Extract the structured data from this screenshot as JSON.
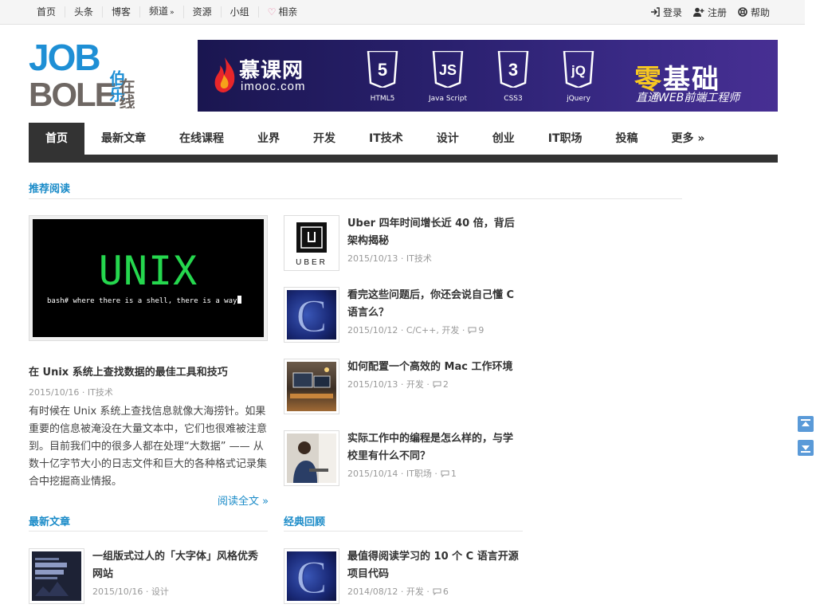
{
  "topbar": {
    "links": [
      "首页",
      "头条",
      "博客",
      "频道",
      "资源",
      "小组",
      "相亲"
    ],
    "login": "登录",
    "register": "注册",
    "help": "帮助"
  },
  "logo": {
    "text_en_1": "JOB",
    "text_en_2": "BOLE",
    "text_cn_1": "伯乐",
    "text_cn_2": "在线"
  },
  "banner": {
    "brand_cn": "慕课网",
    "brand_en": "imooc.com",
    "techs": [
      "HTML5",
      "Java Script",
      "CSS3",
      "jQuery"
    ],
    "headline": "零基础",
    "headline_accent": "零",
    "headline_rest": "基础",
    "subline": "直通WEB前端工程师"
  },
  "mainnav": [
    "首页",
    "最新文章",
    "在线课程",
    "业界",
    "开发",
    "IT技术",
    "设计",
    "创业",
    "IT职场",
    "投稿",
    "更多 »"
  ],
  "sections": {
    "recommend": "推荐阅读",
    "latest": "最新文章",
    "classic": "经典回顾"
  },
  "featured": {
    "image_title": "UNIX",
    "image_prompt": "bash# where there is a shell, there is a way",
    "title": "在 Unix 系统上查找数据的最佳工具和技巧",
    "meta": "2015/10/16 · IT技术",
    "desc": "有时候在 Unix 系统上查找信息就像大海捞针。如果重要的信息被淹没在大量文本中，它们也很难被注意到。目前我们中的很多人都在处理“大数据” —— 从数十亿字节大小的日志文件和巨大的各种格式记录集合中挖掘商业情报。",
    "more": "阅读全文 »"
  },
  "side_items": [
    {
      "title": "Uber 四年时间增长近 40 倍，背后架构揭秘",
      "meta": "2015/10/13 · IT技术",
      "comments": "",
      "thumb": "uber",
      "thumb_text": "UBER"
    },
    {
      "title": "看完这些问题后，你还会说自己懂 C 语言么？",
      "meta": "2015/10/12 · C/C++, 开发 ·",
      "comments": "9",
      "thumb": "c"
    },
    {
      "title": "如何配置一个高效的 Mac 工作环境",
      "meta": "2015/10/13 · 开发 ·",
      "comments": "2",
      "thumb": "mac"
    },
    {
      "title": "实际工作中的编程是怎么样的，与学校里有什么不同？",
      "meta": "2015/10/14 · IT职场 ·",
      "comments": "1",
      "thumb": "work"
    }
  ],
  "latest_items": [
    {
      "title": "一组版式过人的「大字体」风格优秀网站",
      "meta": "2015/10/16 · 设计",
      "thumb": "font"
    }
  ],
  "classic_items": [
    {
      "title": "最值得阅读学习的 10 个 C 语言开源项目代码",
      "meta": "2014/08/12 · 开发 ·",
      "comments": "6",
      "thumb": "c"
    }
  ],
  "colors": {
    "accent": "#1a8bc8",
    "nav_dark": "#333333",
    "logo_blue": "#1e8fd5",
    "logo_gray": "#6e6763"
  }
}
